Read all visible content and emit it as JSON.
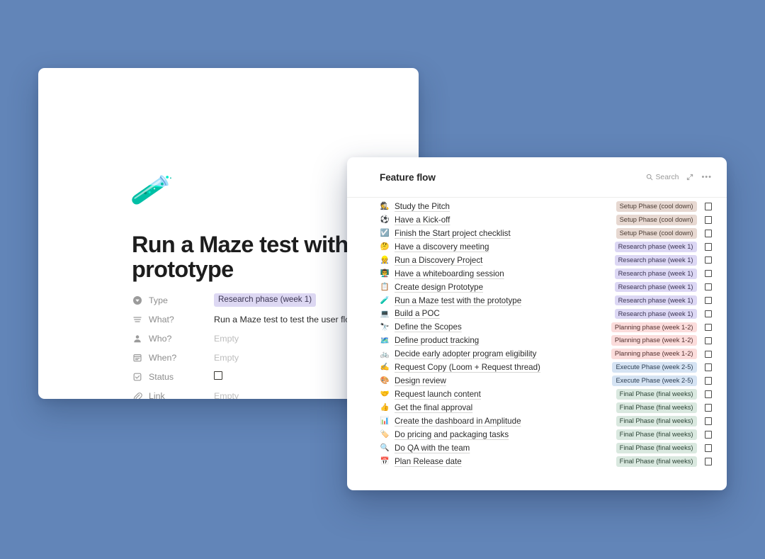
{
  "background_color": "#6285b8",
  "page": {
    "emoji": "🧪",
    "emoji_name": "test-tube-emoji",
    "title": "Run a Maze test with the prototype",
    "properties": [
      {
        "icon": "select-icon",
        "label": "Type",
        "value": "Research phase (week 1)",
        "kind": "tag",
        "tag_color": "#ddd8f3"
      },
      {
        "icon": "text-icon",
        "label": "What?",
        "value": "Run a Maze test to test the user flow and assumptions",
        "kind": "text"
      },
      {
        "icon": "person-icon",
        "label": "Who?",
        "value": "Empty",
        "kind": "empty"
      },
      {
        "icon": "calendar-icon",
        "label": "When?",
        "value": "Empty",
        "kind": "empty"
      },
      {
        "icon": "checkbox-icon",
        "label": "Status",
        "value": "",
        "kind": "checkbox",
        "checked": false
      },
      {
        "icon": "link-icon",
        "label": "Link",
        "value": "Empty",
        "kind": "empty"
      }
    ]
  },
  "flow": {
    "title": "Feature flow",
    "search_label": "Search",
    "expand_label": "",
    "more_label": "",
    "tag_colors": {
      "setup": "#e7d8d1",
      "research": "#dcd7f4",
      "planning": "#fbdcdb",
      "execute": "#d5e3f3",
      "final": "#d9e8df"
    },
    "items": [
      {
        "emoji": "🕵️",
        "emoji_name": "detective-emoji",
        "title": "Study the Pitch",
        "tag": "Setup Phase (cool down)",
        "tag_class": "t-setup",
        "checked": false
      },
      {
        "emoji": "⚽",
        "emoji_name": "soccer-ball-emoji",
        "title": "Have a Kick-off",
        "tag": "Setup Phase (cool down)",
        "tag_class": "t-setup",
        "checked": false
      },
      {
        "emoji": "☑️",
        "emoji_name": "checkbox-checked-emoji",
        "title": "Finish the Start project checklist",
        "tag": "Setup Phase (cool down)",
        "tag_class": "t-setup",
        "checked": false
      },
      {
        "emoji": "🤔",
        "emoji_name": "thinking-face-emoji",
        "title": "Have a discovery meeting",
        "tag": "Research phase (week 1)",
        "tag_class": "t-research",
        "checked": false
      },
      {
        "emoji": "👷",
        "emoji_name": "construction-worker-emoji",
        "title": "Run a Discovery Project",
        "tag": "Research phase (week 1)",
        "tag_class": "t-research",
        "checked": false
      },
      {
        "emoji": "👨‍🏫",
        "emoji_name": "teacher-emoji",
        "title": "Have a whiteboarding session",
        "tag": "Research phase (week 1)",
        "tag_class": "t-research",
        "checked": false
      },
      {
        "emoji": "📋",
        "emoji_name": "clipboard-emoji",
        "title": "Create design Prototype",
        "tag": "Research phase (week 1)",
        "tag_class": "t-research",
        "checked": false
      },
      {
        "emoji": "🧪",
        "emoji_name": "test-tube-emoji",
        "title": "Run a Maze test with the prototype",
        "tag": "Research phase (week 1)",
        "tag_class": "t-research",
        "checked": false
      },
      {
        "emoji": "💻",
        "emoji_name": "laptop-emoji",
        "title": "Build a POC",
        "tag": "Research phase (week 1)",
        "tag_class": "t-research",
        "checked": false
      },
      {
        "emoji": "🔭",
        "emoji_name": "telescope-emoji",
        "title": "Define the Scopes",
        "tag": "Planning phase (week 1-2)",
        "tag_class": "t-planning",
        "checked": false
      },
      {
        "emoji": "🗺️",
        "emoji_name": "map-emoji",
        "title": "Define product tracking",
        "tag": "Planning phase (week 1-2)",
        "tag_class": "t-planning",
        "checked": false
      },
      {
        "emoji": "🚲",
        "emoji_name": "bicycle-emoji",
        "title": "Decide early adopter program eligibility",
        "tag": "Planning phase (week 1-2)",
        "tag_class": "t-planning",
        "checked": false
      },
      {
        "emoji": "✍️",
        "emoji_name": "writing-hand-emoji",
        "title": "Request Copy (Loom + Request thread)",
        "tag": "Execute Phase (week 2-5)",
        "tag_class": "t-execute",
        "checked": false
      },
      {
        "emoji": "🎨",
        "emoji_name": "artist-palette-emoji",
        "title": "Design review",
        "tag": "Execute Phase (week 2-5)",
        "tag_class": "t-execute",
        "checked": false
      },
      {
        "emoji": "🤝",
        "emoji_name": "handshake-emoji",
        "title": "Request launch content",
        "tag": "Final Phase (final weeks)",
        "tag_class": "t-final",
        "checked": false
      },
      {
        "emoji": "👍",
        "emoji_name": "thumbs-up-emoji",
        "title": "Get the final approval",
        "tag": "Final Phase (final weeks)",
        "tag_class": "t-final",
        "checked": false
      },
      {
        "emoji": "📊",
        "emoji_name": "bar-chart-emoji",
        "title": "Create the dashboard in Amplitude",
        "tag": "Final Phase (final weeks)",
        "tag_class": "t-final",
        "checked": false
      },
      {
        "emoji": "🏷️",
        "emoji_name": "label-tag-emoji",
        "title": "Do pricing and packaging tasks",
        "tag": "Final Phase (final weeks)",
        "tag_class": "t-final",
        "checked": false
      },
      {
        "emoji": "🔍",
        "emoji_name": "magnifying-glass-emoji",
        "title": "Do QA with the team",
        "tag": "Final Phase (final weeks)",
        "tag_class": "t-final",
        "checked": false
      },
      {
        "emoji": "📅",
        "emoji_name": "calendar-emoji",
        "title": "Plan Release date",
        "tag": "Final Phase (final weeks)",
        "tag_class": "t-final",
        "checked": false
      }
    ]
  }
}
